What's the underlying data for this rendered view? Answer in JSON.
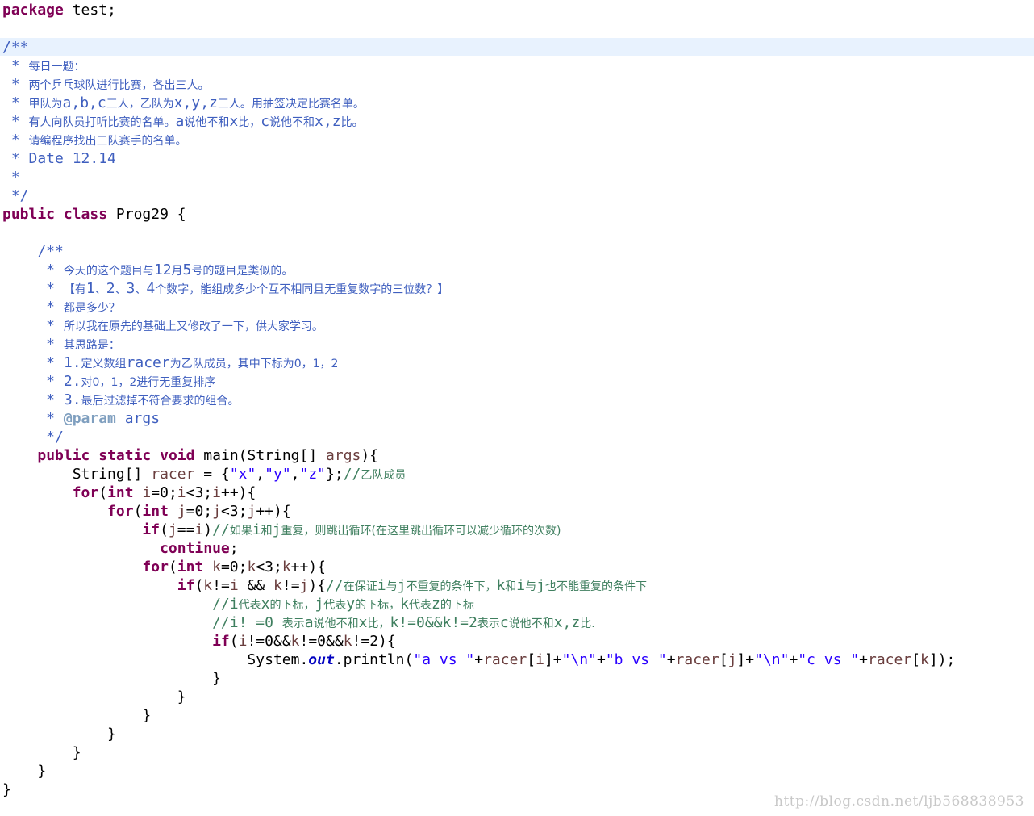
{
  "code_lines": [
    [
      {
        "t": "package",
        "c": "kw"
      },
      {
        "t": " test;"
      }
    ],
    [],
    [
      {
        "t": "/**",
        "c": "doc"
      }
    ],
    [
      {
        "t": " * ",
        "c": "doc"
      },
      {
        "t": "每日一题：",
        "c": "doc",
        "z": 1
      }
    ],
    [
      {
        "t": " * ",
        "c": "doc"
      },
      {
        "t": "两个乒乓球队进行比赛，各出三人。",
        "c": "doc",
        "z": 1
      }
    ],
    [
      {
        "t": " * ",
        "c": "doc"
      },
      {
        "t": "甲队为",
        "c": "doc",
        "z": 1
      },
      {
        "t": "a,b,c",
        "c": "doc"
      },
      {
        "t": "三人，乙队为",
        "c": "doc",
        "z": 1
      },
      {
        "t": "x,y,z",
        "c": "doc"
      },
      {
        "t": "三人。用抽签决定比赛名单。",
        "c": "doc",
        "z": 1
      }
    ],
    [
      {
        "t": " * ",
        "c": "doc"
      },
      {
        "t": "有人向队员打听比赛的名单。",
        "c": "doc",
        "z": 1
      },
      {
        "t": "a",
        "c": "doc"
      },
      {
        "t": "说他不和",
        "c": "doc",
        "z": 1
      },
      {
        "t": "x",
        "c": "doc"
      },
      {
        "t": "比，",
        "c": "doc",
        "z": 1
      },
      {
        "t": "c",
        "c": "doc"
      },
      {
        "t": "说他不和",
        "c": "doc",
        "z": 1
      },
      {
        "t": "x,z",
        "c": "doc"
      },
      {
        "t": "比。",
        "c": "doc",
        "z": 1
      }
    ],
    [
      {
        "t": " * ",
        "c": "doc"
      },
      {
        "t": "请编程序找出三队赛手的名单。",
        "c": "doc",
        "z": 1
      }
    ],
    [
      {
        "t": " * Date 12.14",
        "c": "doc"
      }
    ],
    [
      {
        "t": " *",
        "c": "doc"
      }
    ],
    [
      {
        "t": " */",
        "c": "doc"
      }
    ],
    [
      {
        "t": "public",
        "c": "kw"
      },
      {
        "t": " "
      },
      {
        "t": "class",
        "c": "kw"
      },
      {
        "t": " Prog29 {"
      }
    ],
    [],
    [
      {
        "t": "    /**",
        "c": "doc"
      }
    ],
    [
      {
        "t": "     * ",
        "c": "doc"
      },
      {
        "t": "今天的这个题目与",
        "c": "doc",
        "z": 1
      },
      {
        "t": "12",
        "c": "doc"
      },
      {
        "t": "月",
        "c": "doc",
        "z": 1
      },
      {
        "t": "5",
        "c": "doc"
      },
      {
        "t": "号的题目是类似的。",
        "c": "doc",
        "z": 1
      }
    ],
    [
      {
        "t": "     * ",
        "c": "doc"
      },
      {
        "t": "【有",
        "c": "doc",
        "z": 1
      },
      {
        "t": "1",
        "c": "doc"
      },
      {
        "t": "、",
        "c": "doc",
        "z": 1
      },
      {
        "t": "2",
        "c": "doc"
      },
      {
        "t": "、",
        "c": "doc",
        "z": 1
      },
      {
        "t": "3",
        "c": "doc"
      },
      {
        "t": "、",
        "c": "doc",
        "z": 1
      },
      {
        "t": "4",
        "c": "doc"
      },
      {
        "t": "个数字，能组成多少个互不相同且无重复数字的三位数？】",
        "c": "doc",
        "z": 1
      }
    ],
    [
      {
        "t": "     * ",
        "c": "doc"
      },
      {
        "t": "都是多少？",
        "c": "doc",
        "z": 1
      }
    ],
    [
      {
        "t": "     * ",
        "c": "doc"
      },
      {
        "t": "所以我在原先的基础上又修改了一下，供大家学习。",
        "c": "doc",
        "z": 1
      }
    ],
    [
      {
        "t": "     * ",
        "c": "doc"
      },
      {
        "t": "其思路是：",
        "c": "doc",
        "z": 1
      }
    ],
    [
      {
        "t": "     * 1.",
        "c": "doc"
      },
      {
        "t": "定义数组",
        "c": "doc",
        "z": 1
      },
      {
        "t": "racer",
        "c": "doc"
      },
      {
        "t": "为乙队成员，其中下标为0，1，2",
        "c": "doc",
        "z": 1
      }
    ],
    [
      {
        "t": "     * 2.",
        "c": "doc"
      },
      {
        "t": "对0，1，2进行无重复排序",
        "c": "doc",
        "z": 1
      }
    ],
    [
      {
        "t": "     * 3.",
        "c": "doc"
      },
      {
        "t": "最后过滤掉不符合要求的组合。",
        "c": "doc",
        "z": 1
      }
    ],
    [
      {
        "t": "     * ",
        "c": "doc"
      },
      {
        "t": "@param",
        "c": "tag"
      },
      {
        "t": " args",
        "c": "doc"
      }
    ],
    [
      {
        "t": "     */",
        "c": "doc"
      }
    ],
    [
      {
        "t": "    "
      },
      {
        "t": "public",
        "c": "kw"
      },
      {
        "t": " "
      },
      {
        "t": "static",
        "c": "kw"
      },
      {
        "t": " "
      },
      {
        "t": "void",
        "c": "kw"
      },
      {
        "t": " main(String[] "
      },
      {
        "t": "args",
        "c": "var"
      },
      {
        "t": "){"
      }
    ],
    [
      {
        "t": "        String[] "
      },
      {
        "t": "racer",
        "c": "var"
      },
      {
        "t": " = {"
      },
      {
        "t": "\"x\"",
        "c": "str"
      },
      {
        "t": ","
      },
      {
        "t": "\"y\"",
        "c": "str"
      },
      {
        "t": ","
      },
      {
        "t": "\"z\"",
        "c": "str"
      },
      {
        "t": "};"
      },
      {
        "t": "//",
        "c": "cmt"
      },
      {
        "t": "乙队成员",
        "c": "cmt",
        "z": 1
      }
    ],
    [
      {
        "t": "        "
      },
      {
        "t": "for",
        "c": "kw"
      },
      {
        "t": "("
      },
      {
        "t": "int",
        "c": "kw"
      },
      {
        "t": " "
      },
      {
        "t": "i",
        "c": "var"
      },
      {
        "t": "=0;"
      },
      {
        "t": "i",
        "c": "var"
      },
      {
        "t": "<3;"
      },
      {
        "t": "i",
        "c": "var"
      },
      {
        "t": "++){"
      }
    ],
    [
      {
        "t": "            "
      },
      {
        "t": "for",
        "c": "kw"
      },
      {
        "t": "("
      },
      {
        "t": "int",
        "c": "kw"
      },
      {
        "t": " "
      },
      {
        "t": "j",
        "c": "var"
      },
      {
        "t": "=0;"
      },
      {
        "t": "j",
        "c": "var"
      },
      {
        "t": "<3;"
      },
      {
        "t": "j",
        "c": "var"
      },
      {
        "t": "++){"
      }
    ],
    [
      {
        "t": "                "
      },
      {
        "t": "if",
        "c": "kw"
      },
      {
        "t": "("
      },
      {
        "t": "j",
        "c": "var"
      },
      {
        "t": "=="
      },
      {
        "t": "i",
        "c": "var"
      },
      {
        "t": ")"
      },
      {
        "t": "//",
        "c": "cmt"
      },
      {
        "t": "如果",
        "c": "cmt",
        "z": 1
      },
      {
        "t": "i",
        "c": "cmt"
      },
      {
        "t": "和",
        "c": "cmt",
        "z": 1
      },
      {
        "t": "j",
        "c": "cmt"
      },
      {
        "t": "重复，则跳出循环(在这里跳出循环可以减少循环的次数)",
        "c": "cmt",
        "z": 1
      }
    ],
    [
      {
        "t": "                  "
      },
      {
        "t": "continue",
        "c": "kw"
      },
      {
        "t": ";"
      }
    ],
    [
      {
        "t": "                "
      },
      {
        "t": "for",
        "c": "kw"
      },
      {
        "t": "("
      },
      {
        "t": "int",
        "c": "kw"
      },
      {
        "t": " "
      },
      {
        "t": "k",
        "c": "var"
      },
      {
        "t": "=0;"
      },
      {
        "t": "k",
        "c": "var"
      },
      {
        "t": "<3;"
      },
      {
        "t": "k",
        "c": "var"
      },
      {
        "t": "++){"
      }
    ],
    [
      {
        "t": "                    "
      },
      {
        "t": "if",
        "c": "kw"
      },
      {
        "t": "("
      },
      {
        "t": "k",
        "c": "var"
      },
      {
        "t": "!="
      },
      {
        "t": "i",
        "c": "var"
      },
      {
        "t": " && "
      },
      {
        "t": "k",
        "c": "var"
      },
      {
        "t": "!="
      },
      {
        "t": "j",
        "c": "var"
      },
      {
        "t": "){"
      },
      {
        "t": "//",
        "c": "cmt"
      },
      {
        "t": "在保证",
        "c": "cmt",
        "z": 1
      },
      {
        "t": "i",
        "c": "cmt"
      },
      {
        "t": "与",
        "c": "cmt",
        "z": 1
      },
      {
        "t": "j",
        "c": "cmt"
      },
      {
        "t": "不重复的条件下，",
        "c": "cmt",
        "z": 1
      },
      {
        "t": "k",
        "c": "cmt"
      },
      {
        "t": "和",
        "c": "cmt",
        "z": 1
      },
      {
        "t": "i",
        "c": "cmt"
      },
      {
        "t": "与",
        "c": "cmt",
        "z": 1
      },
      {
        "t": "j",
        "c": "cmt"
      },
      {
        "t": "也不能重复的条件下",
        "c": "cmt",
        "z": 1
      }
    ],
    [
      {
        "t": "                        //",
        "c": "cmt"
      },
      {
        "t": "i",
        "c": "cmt"
      },
      {
        "t": "代表",
        "c": "cmt",
        "z": 1
      },
      {
        "t": "x",
        "c": "cmt"
      },
      {
        "t": "的下标，",
        "c": "cmt",
        "z": 1
      },
      {
        "t": "j",
        "c": "cmt"
      },
      {
        "t": "代表",
        "c": "cmt",
        "z": 1
      },
      {
        "t": "y",
        "c": "cmt"
      },
      {
        "t": "的下标，",
        "c": "cmt",
        "z": 1
      },
      {
        "t": "k",
        "c": "cmt"
      },
      {
        "t": "代表",
        "c": "cmt",
        "z": 1
      },
      {
        "t": "z",
        "c": "cmt"
      },
      {
        "t": "的下标",
        "c": "cmt",
        "z": 1
      }
    ],
    [
      {
        "t": "                        //i! =0 ",
        "c": "cmt"
      },
      {
        "t": "表示",
        "c": "cmt",
        "z": 1
      },
      {
        "t": "a",
        "c": "cmt"
      },
      {
        "t": "说他不和",
        "c": "cmt",
        "z": 1
      },
      {
        "t": "x",
        "c": "cmt"
      },
      {
        "t": "比，",
        "c": "cmt",
        "z": 1
      },
      {
        "t": "k!=0&&k!=2",
        "c": "cmt"
      },
      {
        "t": "表示",
        "c": "cmt",
        "z": 1
      },
      {
        "t": "c",
        "c": "cmt"
      },
      {
        "t": "说他不和",
        "c": "cmt",
        "z": 1
      },
      {
        "t": "x,z",
        "c": "cmt"
      },
      {
        "t": "比.",
        "c": "cmt",
        "z": 1
      }
    ],
    [
      {
        "t": "                        "
      },
      {
        "t": "if",
        "c": "kw"
      },
      {
        "t": "("
      },
      {
        "t": "i",
        "c": "var"
      },
      {
        "t": "!=0&&"
      },
      {
        "t": "k",
        "c": "var"
      },
      {
        "t": "!=0&&"
      },
      {
        "t": "k",
        "c": "var"
      },
      {
        "t": "!=2){"
      }
    ],
    [
      {
        "t": "                            System."
      },
      {
        "t": "out",
        "c": "fld"
      },
      {
        "t": ".println("
      },
      {
        "t": "\"a vs \"",
        "c": "str"
      },
      {
        "t": "+"
      },
      {
        "t": "racer",
        "c": "var"
      },
      {
        "t": "["
      },
      {
        "t": "i",
        "c": "var"
      },
      {
        "t": "]+"
      },
      {
        "t": "\"\\n\"",
        "c": "str"
      },
      {
        "t": "+"
      },
      {
        "t": "\"b vs \"",
        "c": "str"
      },
      {
        "t": "+"
      },
      {
        "t": "racer",
        "c": "var"
      },
      {
        "t": "["
      },
      {
        "t": "j",
        "c": "var"
      },
      {
        "t": "]+"
      },
      {
        "t": "\"\\n\"",
        "c": "str"
      },
      {
        "t": "+"
      },
      {
        "t": "\"c vs \"",
        "c": "str"
      },
      {
        "t": "+"
      },
      {
        "t": "racer",
        "c": "var"
      },
      {
        "t": "["
      },
      {
        "t": "k",
        "c": "var"
      },
      {
        "t": "]);"
      }
    ],
    [
      {
        "t": "                        }"
      }
    ],
    [
      {
        "t": "                    }"
      }
    ],
    [
      {
        "t": "                }"
      }
    ],
    [
      {
        "t": "            }"
      }
    ],
    [
      {
        "t": "        }"
      }
    ],
    [
      {
        "t": "    }"
      }
    ],
    [
      {
        "t": "}"
      }
    ]
  ],
  "highlighted_line": 2,
  "watermark": "http://blog.csdn.net/ljb568838953",
  "colors": {
    "keyword": "#7f0055",
    "string": "#2a00ff",
    "javadoc": "#3f5fbf",
    "comment": "#3f7f5f",
    "variable": "#6a3e3e",
    "static_field": "#0000c0",
    "javadoc_tag": "#7f9fbf",
    "current_line": "#e8f2fe",
    "watermark": "#c8c8c8"
  }
}
